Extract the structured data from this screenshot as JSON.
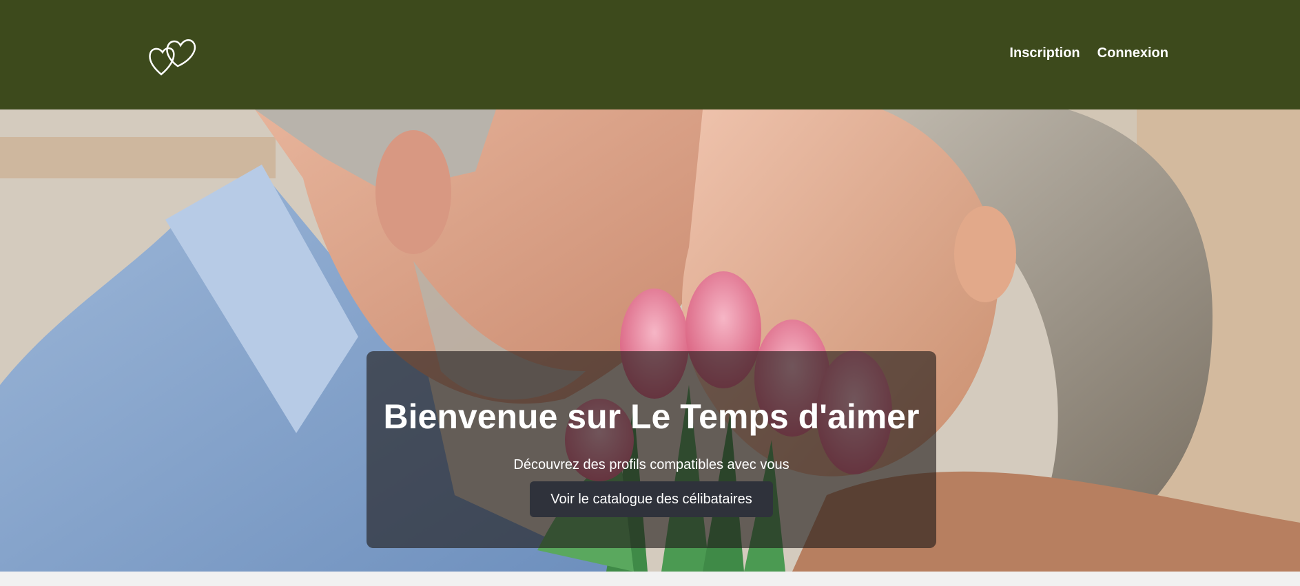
{
  "header": {
    "logo_icon": "double-heart-icon",
    "nav": [
      {
        "label": "Inscription"
      },
      {
        "label": "Connexion"
      }
    ],
    "background_color": "#3d4a1c"
  },
  "hero": {
    "image": "couple-with-tulips-photo",
    "title": "Bienvenue sur Le Temps d'aimer",
    "subtitle": "Découvrez des profils compatibles avec vous",
    "cta_label": "Voir le catalogue des célibataires"
  }
}
